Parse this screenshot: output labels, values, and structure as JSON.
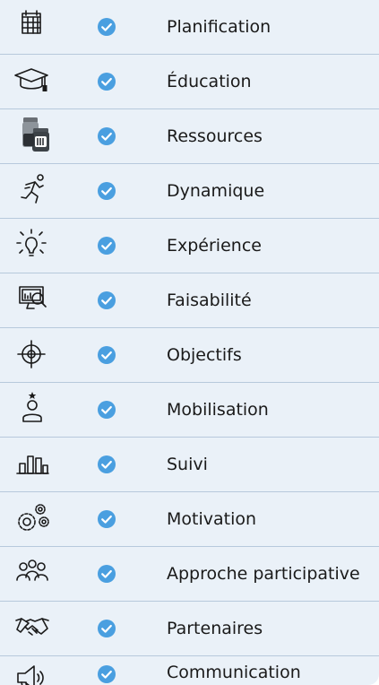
{
  "colors": {
    "background": "#eaf1f8",
    "divider": "#b7c9dc",
    "check": "#4a9fe0",
    "text": "#1a1a1a"
  },
  "items": [
    {
      "label": "Planification",
      "icon": "calendar-icon"
    },
    {
      "label": "Éducation",
      "icon": "graduation-cap-icon"
    },
    {
      "label": "Ressources",
      "icon": "jars-icon"
    },
    {
      "label": "Dynamique",
      "icon": "runner-icon"
    },
    {
      "label": "Expérience",
      "icon": "lightbulb-icon"
    },
    {
      "label": "Faisabilité",
      "icon": "monitor-search-icon"
    },
    {
      "label": "Objectifs",
      "icon": "target-icon"
    },
    {
      "label": "Mobilisation",
      "icon": "person-star-icon"
    },
    {
      "label": "Suivi",
      "icon": "bar-chart-icon"
    },
    {
      "label": "Motivation",
      "icon": "gears-icon"
    },
    {
      "label": "Approche participative",
      "icon": "group-icon"
    },
    {
      "label": "Partenaires",
      "icon": "handshake-icon"
    },
    {
      "label": "Communication",
      "icon": "megaphone-icon"
    }
  ],
  "check_icon": "check-circle-icon"
}
